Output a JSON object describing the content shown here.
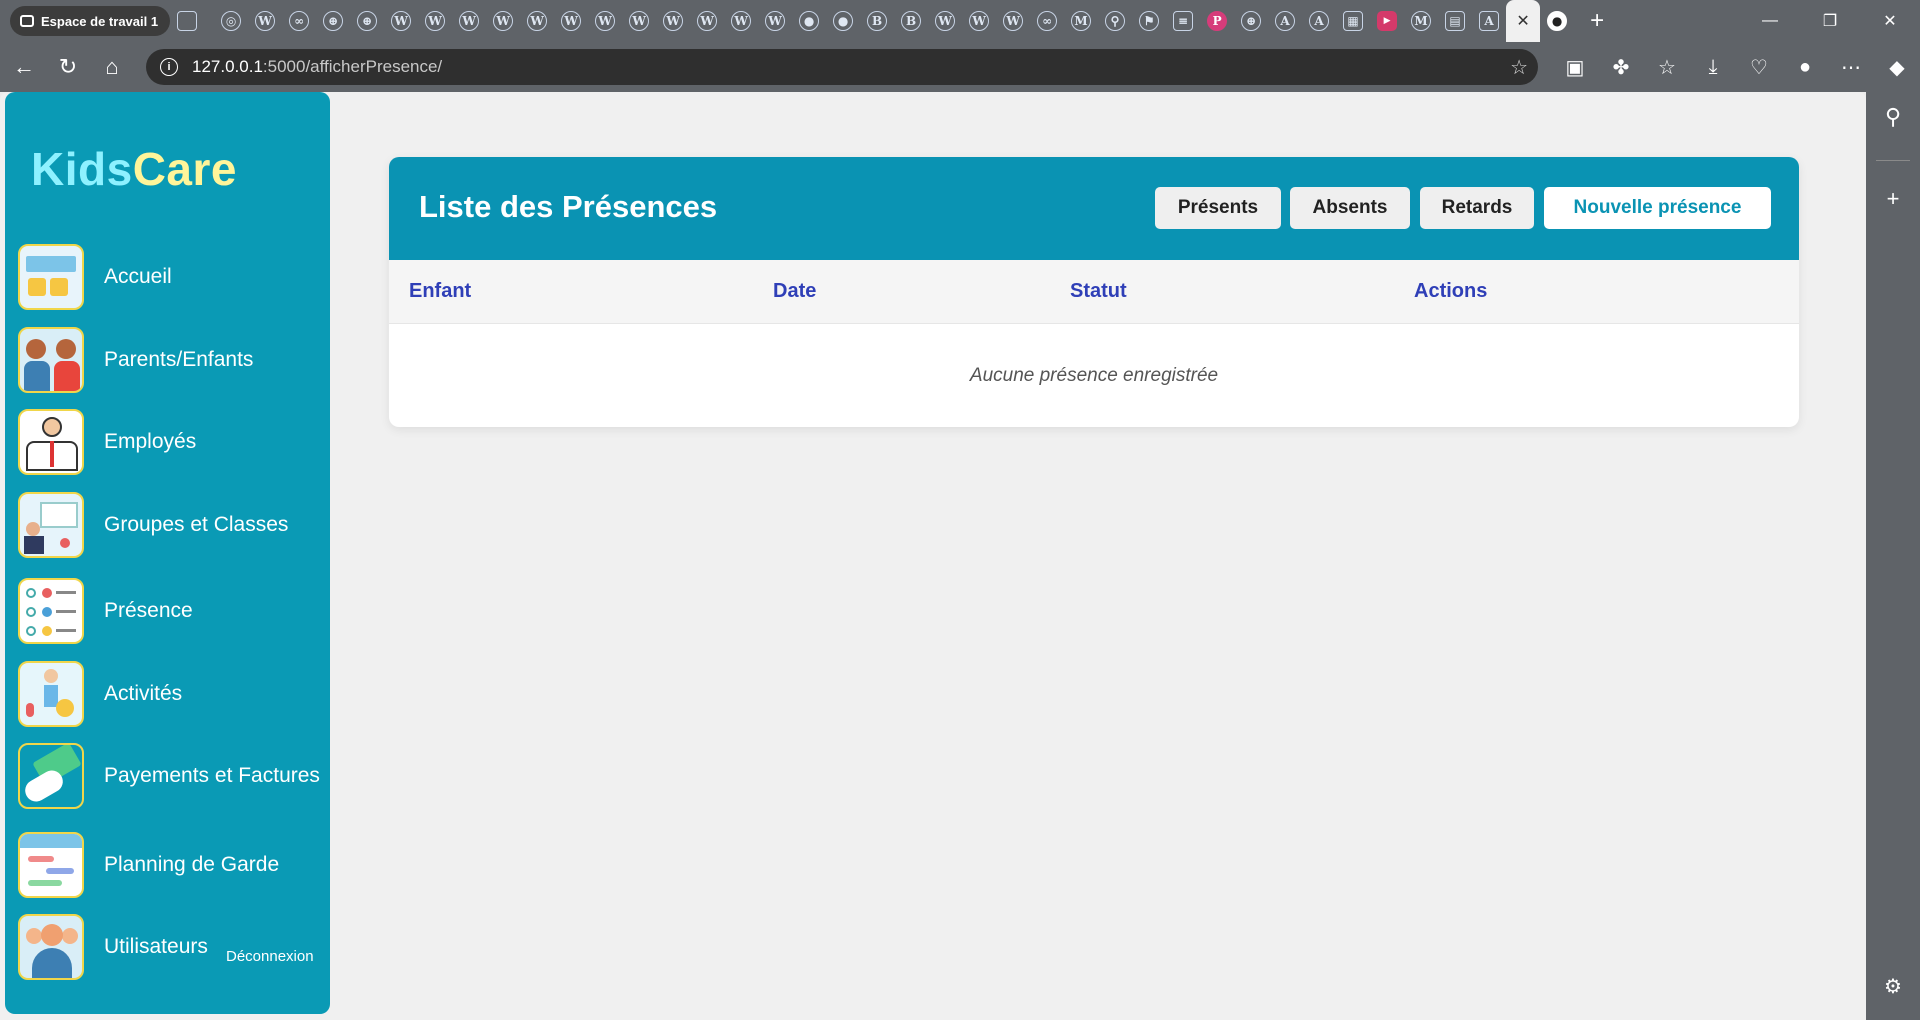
{
  "browser": {
    "workspace_label": "Espace de travail 1",
    "url_host": "127.0.0.1",
    "url_path": ":5000/afficherPresence/"
  },
  "app": {
    "logo_part1": "Kids",
    "logo_part2": "Care",
    "logout_label": "Déconnexion",
    "menu": [
      {
        "label": "Accueil",
        "icon": "dashboard-icon"
      },
      {
        "label": "Parents/Enfants",
        "icon": "family-icon"
      },
      {
        "label": "Employés",
        "icon": "employees-icon"
      },
      {
        "label": "Groupes et Classes",
        "icon": "classroom-icon"
      },
      {
        "label": "Présence",
        "icon": "checklist-icon"
      },
      {
        "label": "Activités",
        "icon": "activity-icon"
      },
      {
        "label": "Payements et Factures",
        "icon": "payment-icon"
      },
      {
        "label": "Planning de Garde",
        "icon": "calendar-icon"
      },
      {
        "label": "Utilisateurs",
        "icon": "users-icon"
      }
    ]
  },
  "page": {
    "title": "Liste des Présences",
    "filters": {
      "present": "Présents",
      "absent": "Absents",
      "late": "Retards"
    },
    "new_button": "Nouvelle présence",
    "columns": [
      "Enfant",
      "Date",
      "Statut",
      "Actions"
    ],
    "empty_message": "Aucune présence enregistrée"
  },
  "colors": {
    "sidebar": "#0a9ab5",
    "header": "#0a93b3",
    "column_text": "#2f3fb7"
  }
}
